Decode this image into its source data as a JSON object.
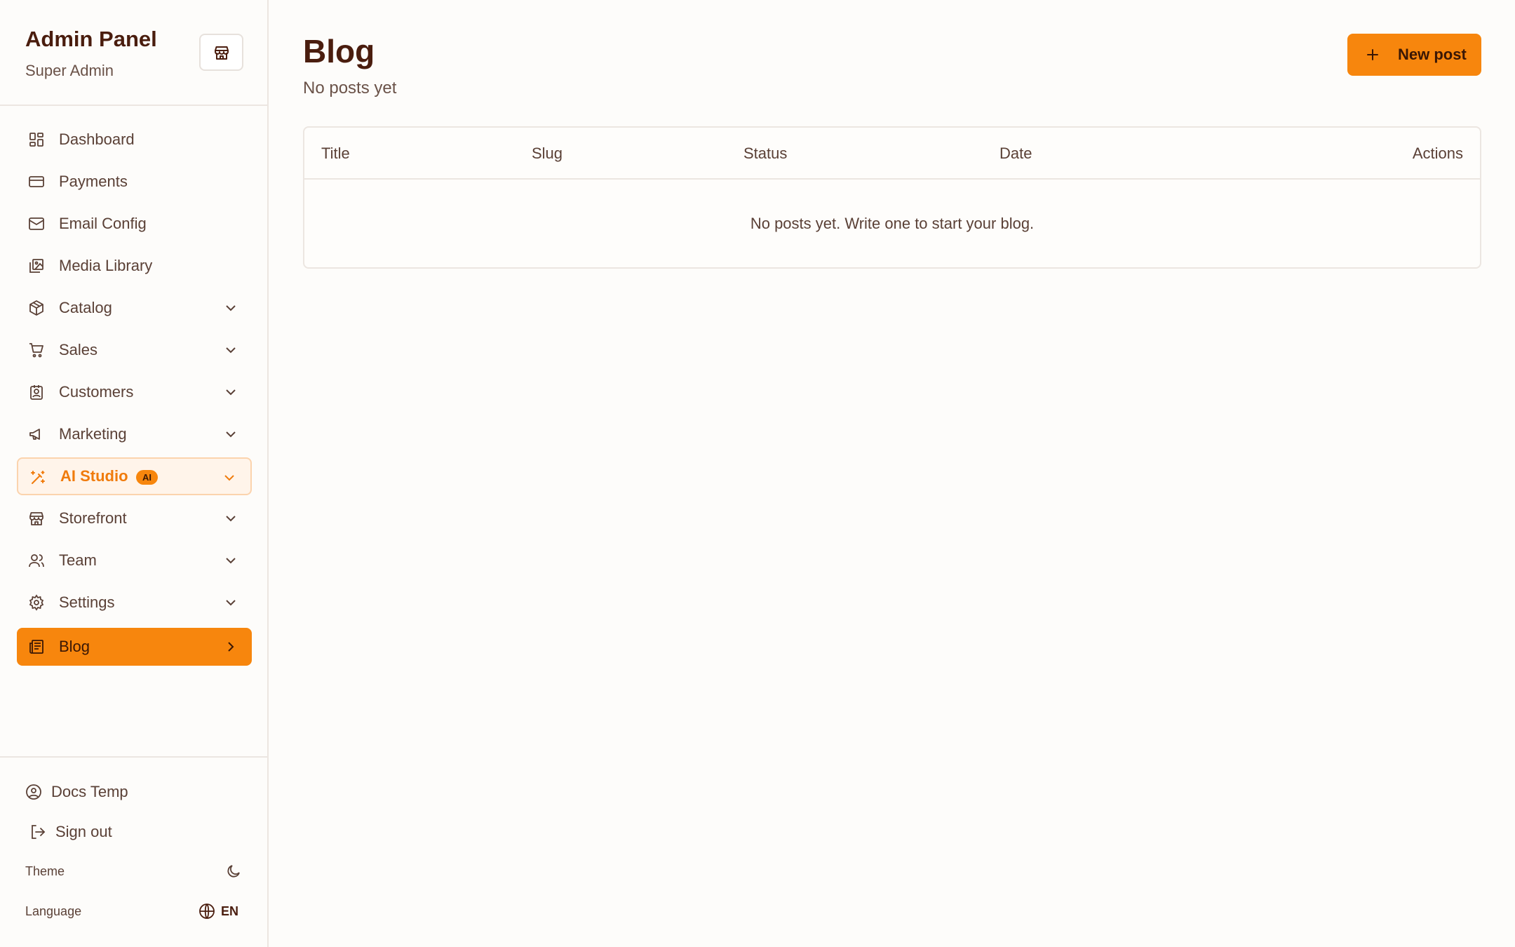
{
  "sidebar": {
    "title": "Admin Panel",
    "subtitle": "Super Admin",
    "items": [
      {
        "label": "Dashboard",
        "icon": "dashboard-icon"
      },
      {
        "label": "Payments",
        "icon": "credit-card-icon"
      },
      {
        "label": "Email Config",
        "icon": "mail-icon"
      },
      {
        "label": "Media Library",
        "icon": "image-library-icon"
      },
      {
        "label": "Catalog",
        "icon": "package-icon",
        "expandable": true
      },
      {
        "label": "Sales",
        "icon": "cart-icon",
        "expandable": true
      },
      {
        "label": "Customers",
        "icon": "contact-icon",
        "expandable": true
      },
      {
        "label": "Marketing",
        "icon": "megaphone-icon",
        "expandable": true
      },
      {
        "label": "AI Studio",
        "icon": "magic-wand-icon",
        "badge": "AI",
        "expandable": true
      },
      {
        "label": "Storefront",
        "icon": "store-icon",
        "expandable": true
      },
      {
        "label": "Team",
        "icon": "users-icon",
        "expandable": true
      },
      {
        "label": "Settings",
        "icon": "gear-icon",
        "expandable": true
      },
      {
        "label": "Blog",
        "icon": "newspaper-icon",
        "active": true
      }
    ],
    "footer": {
      "user": "Docs Temp",
      "signout": "Sign out",
      "theme_label": "Theme",
      "language_label": "Language",
      "language_value": "EN"
    }
  },
  "main": {
    "title": "Blog",
    "subtitle": "No posts yet",
    "new_button": "New post",
    "columns": [
      "Title",
      "Slug",
      "Status",
      "Date",
      "Actions"
    ],
    "empty_message": "No posts yet. Write one to start your blog."
  },
  "colors": {
    "accent": "#f7860d",
    "title": "#4a1d0e",
    "text": "#5a4036",
    "border": "#ece6e1",
    "ai_bg": "#fff4ea"
  }
}
